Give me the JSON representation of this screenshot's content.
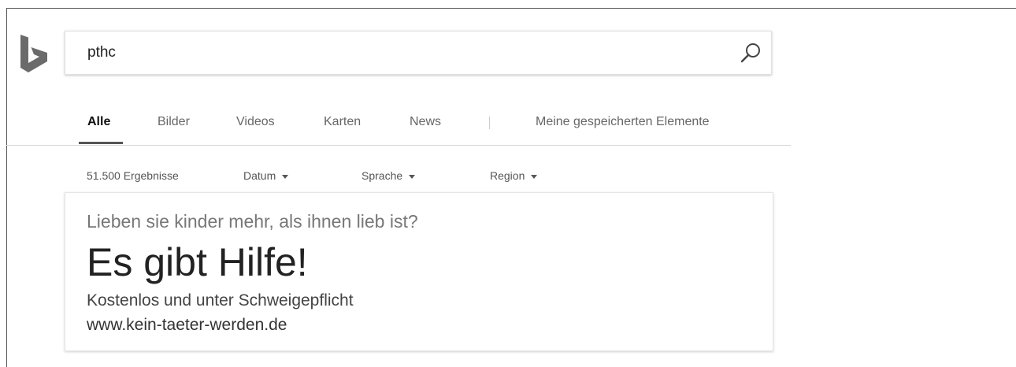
{
  "search": {
    "query": "pthc",
    "search_icon": "magnifier-icon"
  },
  "logo": {
    "icon": "bing-logo-icon"
  },
  "tabs": [
    {
      "label": "Alle",
      "active": true
    },
    {
      "label": "Bilder"
    },
    {
      "label": "Videos"
    },
    {
      "label": "Karten"
    },
    {
      "label": "News"
    },
    {
      "label": "Meine gespeicherten Elemente"
    }
  ],
  "filters": {
    "result_count": "51.500 Ergebnisse",
    "date": "Datum",
    "language": "Sprache",
    "region": "Region"
  },
  "ad": {
    "tagline": "Lieben sie kinder mehr, als ihnen lieb ist?",
    "headline": "Es gibt Hilfe!",
    "description": "Kostenlos und unter Schweigepflicht",
    "url": "www.kein-taeter-werden.de"
  },
  "colors": {
    "text_primary": "#222222",
    "text_secondary": "#666666",
    "logo": "#666666"
  }
}
